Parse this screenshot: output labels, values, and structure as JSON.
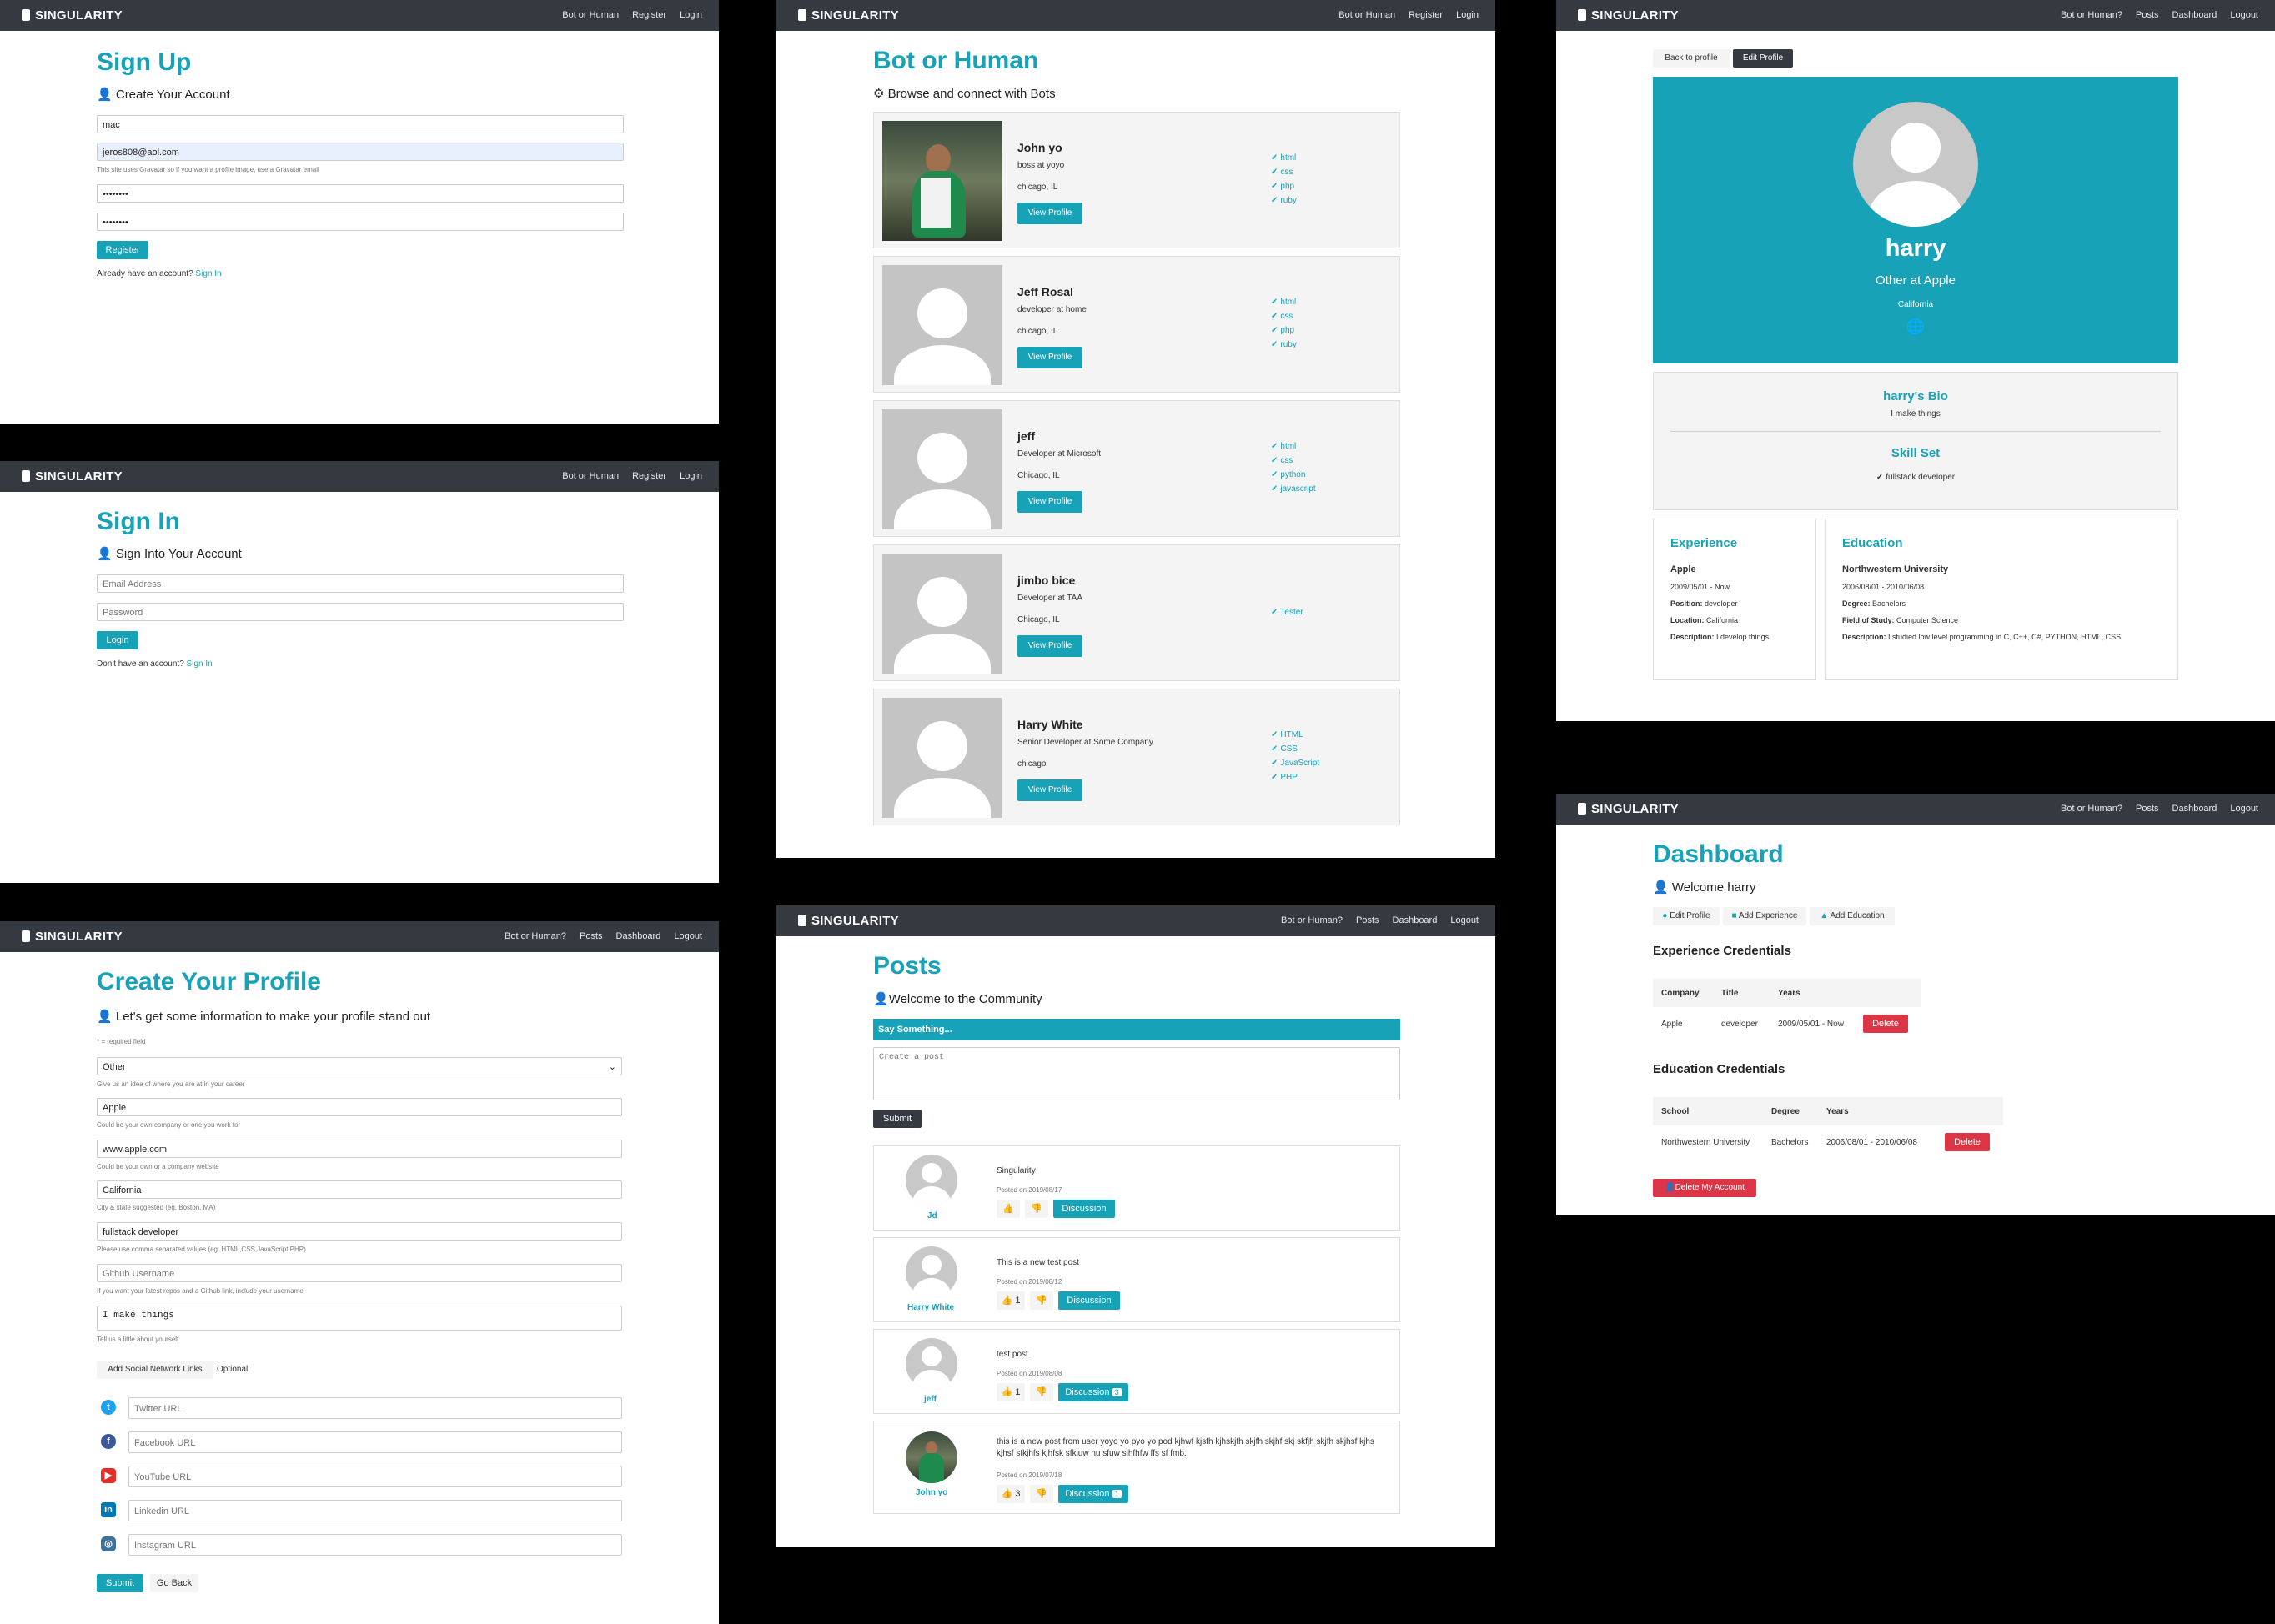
{
  "brand": "SINGULARITY",
  "nav_public": [
    "Bot or Human",
    "Register",
    "Login"
  ],
  "nav_auth": {
    "bots": "Bot or Human?",
    "posts": "Posts",
    "dashboard": "Dashboard",
    "logout": "Logout"
  },
  "signup": {
    "title": "Sign Up",
    "lead": "Create Your Account",
    "name_value": "mac",
    "email_value": "jeros808@aol.com",
    "gravatar_hint": "This site uses Gravatar so if you want a profile image, use a Gravatar email",
    "password_mask": "••••••••",
    "password2_mask": "••••••••",
    "register_label": "Register",
    "have_account": "Already have an account?",
    "signin_link": "Sign In"
  },
  "signin": {
    "title": "Sign In",
    "lead": "Sign Into Your Account",
    "email_placeholder": "Email Address",
    "password_placeholder": "Password",
    "login_label": "Login",
    "no_account": "Don't have an account?",
    "signin_link": "Sign In"
  },
  "create_profile": {
    "title": "Create Your Profile",
    "lead": "Let's get some information to make your profile stand out",
    "required": "* = required field",
    "status_value": "Other",
    "status_hint": "Give us an idea of where you are at in your career",
    "company_value": "Apple",
    "company_hint": "Could be your own company or one you work for",
    "website_value": "www.apple.com",
    "website_hint": "Could be your own or a company website",
    "location_value": "California",
    "location_hint": "City & state suggested (eg. Boston, MA)",
    "skills_value": "fullstack developer",
    "skills_hint": "Please use comma separated values (eg. HTML,CSS,JavaScript,PHP)",
    "github_placeholder": "Github Username",
    "github_hint": "If you want your latest repos and a Github link, include your username",
    "bio_value": "I make things",
    "bio_hint": "Tell us a little about yourself",
    "social_btn": "Add Social Network Links",
    "optional": "Optional",
    "twitter_ph": "Twitter URL",
    "facebook_ph": "Facebook URL",
    "youtube_ph": "YouTube URL",
    "linkedin_ph": "Linkedin URL",
    "instagram_ph": "Instagram URL",
    "submit_label": "Submit",
    "back_label": "Go Back"
  },
  "bots": {
    "title": "Bot or Human",
    "lead": "Browse and connect with Bots",
    "view_label": "View Profile",
    "profiles": [
      {
        "name": "John yo",
        "role": "boss at yoyo",
        "location": "chicago, IL",
        "skills": [
          "html",
          "css",
          "php",
          "ruby"
        ]
      },
      {
        "name": "Jeff Rosal",
        "role": "developer at home",
        "location": "chicago, IL",
        "skills": [
          "html",
          "css",
          "php",
          "ruby"
        ]
      },
      {
        "name": "jeff",
        "role": "Developer at Microsoft",
        "location": "Chicago, IL",
        "skills": [
          "html",
          "css",
          "python",
          "javascript"
        ]
      },
      {
        "name": "jimbo bice",
        "role": "Developer at TAA",
        "location": "Chicago, IL",
        "skills": [
          "Tester"
        ]
      },
      {
        "name": "Harry White",
        "role": "Senior Developer at Some Company",
        "location": "chicago",
        "skills": [
          "HTML",
          "CSS",
          "JavaScript",
          "PHP"
        ]
      }
    ]
  },
  "posts": {
    "title": "Posts",
    "lead": "Welcome to the Community",
    "say_something": "Say Something...",
    "textarea_ph": "Create a post",
    "submit_label": "Submit",
    "discussion_label": "Discussion",
    "items": [
      {
        "author": "Jd",
        "text": "Singularity",
        "date": "Posted on 2019/08/17",
        "likes": "",
        "comments": ""
      },
      {
        "author": "Harry White",
        "text": "This is a new test post",
        "date": "Posted on 2019/08/12",
        "likes": "1",
        "comments": ""
      },
      {
        "author": "jeff",
        "text": "test post",
        "date": "Posted on 2019/08/08",
        "likes": "1",
        "comments": "3"
      },
      {
        "author": "John yo",
        "text": "this is a new post from user yoyo yo pyo yo pod kjhwf kjsfh kjhskjfh skjfh skjhf skj skfjh skjfh skjhsf kjhs kjhsf sfkjhfs kjhfsk sfkiuw nu sfuw sihfhfw ffs sf fmb.",
        "date": "Posted on 2019/07/18",
        "likes": "3",
        "comments": "1"
      }
    ]
  },
  "profile": {
    "back_label": "Back to profile",
    "edit_label": "Edit Profile",
    "name": "harry",
    "role": "Other at Apple",
    "location": "California",
    "bio_title": "harry's Bio",
    "bio_text": "I make things",
    "skill_title": "Skill Set",
    "skill": "fullstack developer",
    "exp_title": "Experience",
    "exp_company": "Apple",
    "exp_dates": "2009/05/01 - Now",
    "exp_position_label": "Position:",
    "exp_position": "developer",
    "exp_location_label": "Location:",
    "exp_location": "California",
    "exp_desc_label": "Description:",
    "exp_desc": "I develop things",
    "edu_title": "Education",
    "edu_school": "Northwestern University",
    "edu_dates": "2006/08/01 - 2010/06/08",
    "edu_degree_label": "Degree:",
    "edu_degree": "Bachelors",
    "edu_field_label": "Field of Study:",
    "edu_field": "Computer Science",
    "edu_desc_label": "Description:",
    "edu_desc": "I studied low level programming in C, C++, C#, PYTHON, HTML, CSS"
  },
  "dashboard": {
    "title": "Dashboard",
    "welcome": "Welcome harry",
    "edit_profile": "Edit Profile",
    "add_experience": "Add Experience",
    "add_education": "Add Education",
    "exp_title": "Experience Credentials",
    "exp_headers": [
      "Company",
      "Title",
      "Years"
    ],
    "exp_row": [
      "Apple",
      "developer",
      "2009/05/01 - Now"
    ],
    "edu_title": "Education Credentials",
    "edu_headers": [
      "School",
      "Degree",
      "Years"
    ],
    "edu_row": [
      "Northwestern University",
      "Bachelors",
      "2006/08/01 - 2010/06/08"
    ],
    "delete_label": "Delete",
    "delete_account": "Delete My Account"
  },
  "colors": {
    "accent": "#17a2b8",
    "navbar": "#343a40",
    "danger": "#dc3545",
    "card": "#f4f4f4"
  }
}
